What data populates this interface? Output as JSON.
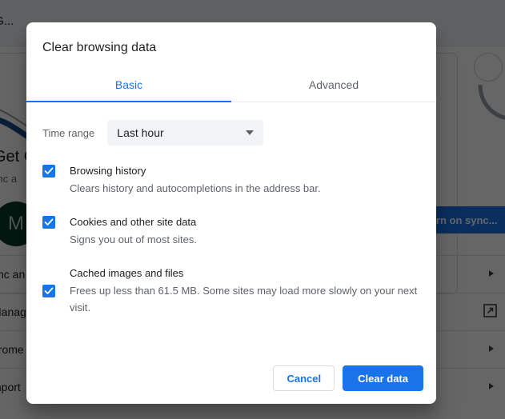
{
  "background": {
    "topbar_text": "and G...",
    "heading": "Get G",
    "subtext": "ync a",
    "avatar_initial": "M",
    "sync_button_label": "Turn on sync...",
    "rows": [
      {
        "label": "ync an",
        "accessory": "chevron"
      },
      {
        "label": "Manag",
        "accessory": "external-link"
      },
      {
        "label": "hrome",
        "accessory": "chevron"
      },
      {
        "label": "mport",
        "accessory": "chevron"
      }
    ]
  },
  "dialog": {
    "title": "Clear browsing data",
    "tabs": [
      {
        "label": "Basic",
        "active": true
      },
      {
        "label": "Advanced",
        "active": false
      }
    ],
    "time_range": {
      "label": "Time range",
      "value": "Last hour"
    },
    "options": [
      {
        "title": "Browsing history",
        "description": "Clears history and autocompletions in the address bar.",
        "checked": true
      },
      {
        "title": "Cookies and other site data",
        "description": "Signs you out of most sites.",
        "checked": true
      },
      {
        "title": "Cached images and files",
        "description": "Frees up less than 61.5 MB. Some sites may load more slowly on your next visit.",
        "checked": true
      }
    ],
    "footer": {
      "cancel_label": "Cancel",
      "confirm_label": "Clear data"
    }
  },
  "colors": {
    "accent": "#1a73e8",
    "text_primary": "#202124",
    "text_secondary": "#5f6368",
    "avatar_bg": "#0b3d2e",
    "scrim": "rgba(0,0,0,0.6)"
  }
}
